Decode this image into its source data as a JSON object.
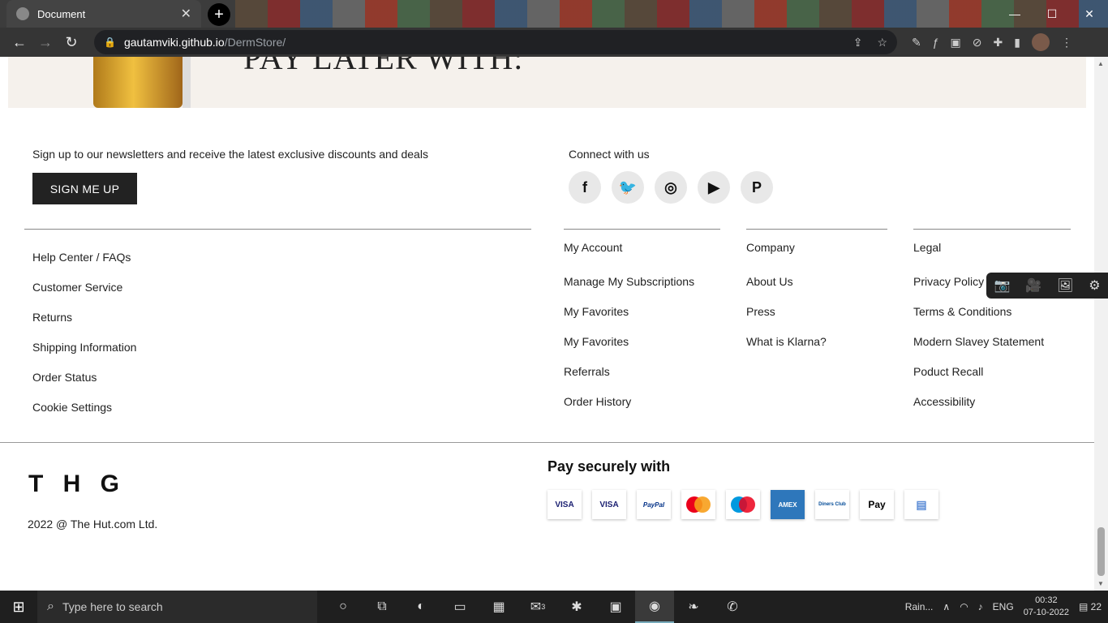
{
  "browser": {
    "tab_title": "Document",
    "url_host": "gautamviki.github.io",
    "url_path": "/DermStore/"
  },
  "banner": {
    "text": "PAY LATER WITH:"
  },
  "newsletter": {
    "text": "Sign up to our newsletters and receive the latest exclusive discounts and deals",
    "button": "SIGN ME UP"
  },
  "connect": {
    "title": "Connect with us",
    "icons": [
      "facebook-icon",
      "twitter-icon",
      "instagram-icon",
      "youtube-icon",
      "pinterest-icon"
    ]
  },
  "help_links": [
    "Help Center / FAQs",
    "Customer Service",
    "Returns",
    "Shipping Information",
    "Order Status",
    "Cookie Settings"
  ],
  "account": {
    "title": "My Account",
    "links": [
      "Manage My Subscriptions",
      "My Favorites",
      "My Favorites",
      "Referrals",
      "Order History"
    ]
  },
  "company": {
    "title": "Company",
    "links": [
      "About Us",
      "Press",
      "What is Klarna?"
    ]
  },
  "legal": {
    "title": "Legal",
    "links": [
      "Privacy Policy",
      "Terms & Conditions",
      "Modern Slavey Statement",
      "Poduct Recall",
      "Accessibility"
    ]
  },
  "brand": {
    "logo": "T H G",
    "copyright": "2022 @ The Hut.com Ltd."
  },
  "payment": {
    "title": "Pay securely with",
    "methods": [
      "VISA",
      "VISA",
      "PayPal",
      "Mastercard",
      "Maestro",
      "AMEX",
      "Diners Club",
      "Apple Pay",
      "Card"
    ]
  },
  "taskbar": {
    "search_placeholder": "Type here to search",
    "weather": "Rain...",
    "language": "ENG",
    "time": "00:32",
    "date": "07-10-2022",
    "notifications": "22",
    "mail_badge": "3"
  }
}
